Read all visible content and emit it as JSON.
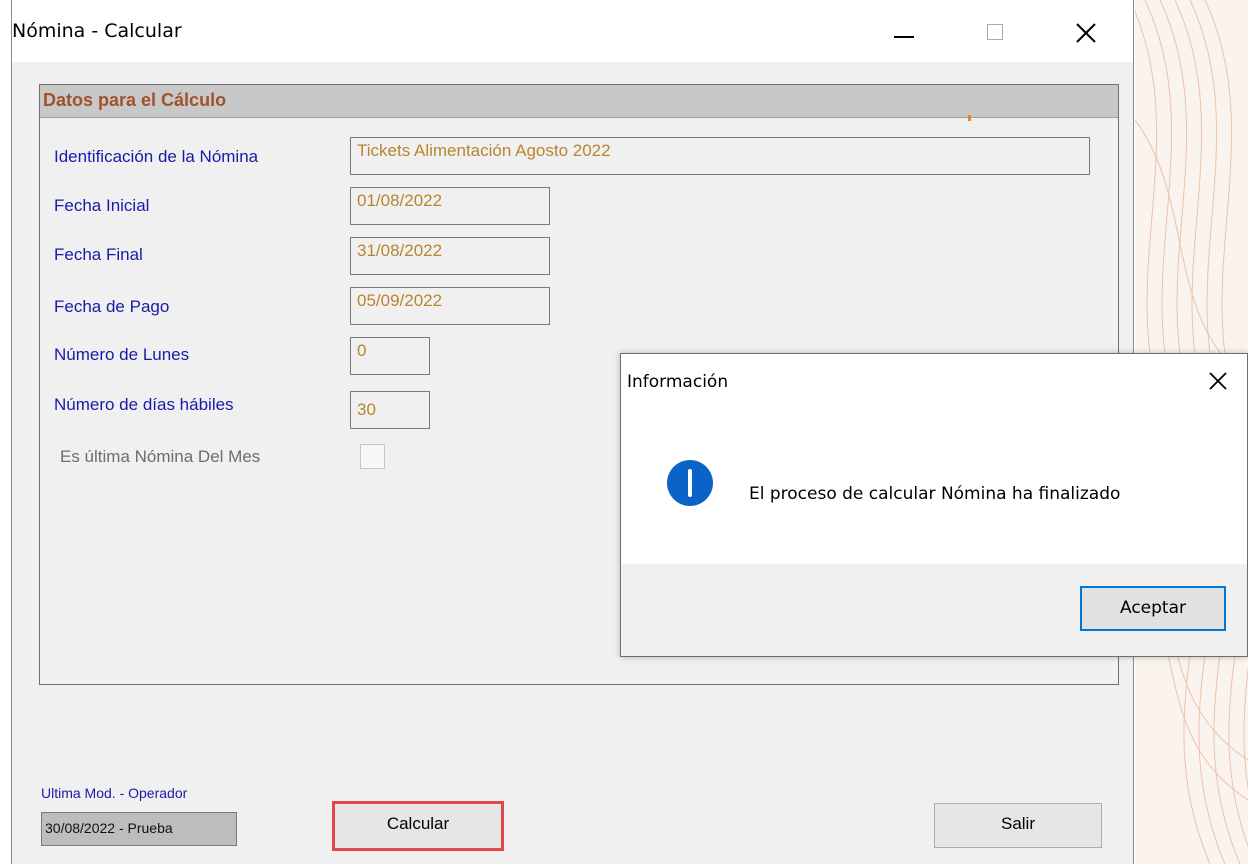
{
  "window": {
    "title": "Nómina - Calcular"
  },
  "group": {
    "title": "Datos para el Cálculo"
  },
  "form": {
    "identificacion_label": "Identificación de la Nómina",
    "identificacion_value": "Tickets Alimentación Agosto 2022",
    "fecha_inicial_label": "Fecha Inicial",
    "fecha_inicial_value": "01/08/2022",
    "fecha_final_label": "Fecha Final",
    "fecha_final_value": "31/08/2022",
    "fecha_pago_label": "Fecha de Pago",
    "fecha_pago_value": "05/09/2022",
    "numero_lunes_label": "Número de Lunes",
    "numero_lunes_value": "0",
    "numero_dias_label": "Número de días hábiles",
    "numero_dias_value": "30",
    "ultima_nomina_label": "Es última Nómina Del Mes",
    "ultima_nomina_checked": false
  },
  "footer": {
    "mod_label": "Ultima Mod. - Operador",
    "mod_value": "30/08/2022 - Prueba",
    "calcular_label": "Calcular",
    "salir_label": "Salir"
  },
  "dialog": {
    "title": "Información",
    "message": "El proceso de calcular Nómina ha finalizado",
    "ok_label": "Aceptar",
    "icon": "info-icon"
  },
  "colors": {
    "label_blue": "#1a1aa8",
    "value_gold": "#b8862e",
    "group_title": "#a0522d",
    "highlight_red": "#e04848",
    "info_blue": "#0a64c8",
    "focus_blue": "#0078d7"
  }
}
